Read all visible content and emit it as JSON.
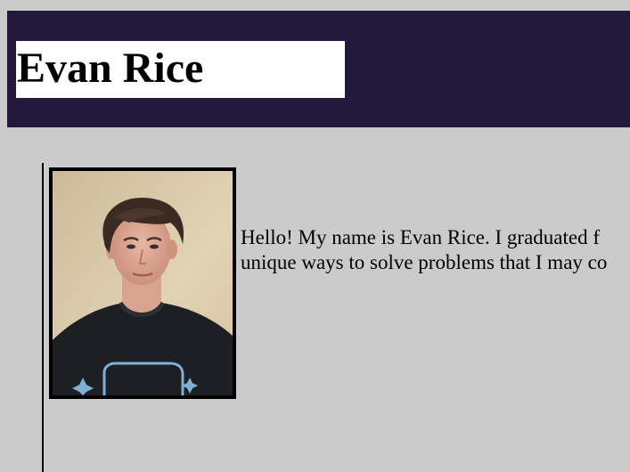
{
  "header": {
    "name": "Evan Rice"
  },
  "profile": {
    "photo_icon": "portrait-photo"
  },
  "bio": {
    "line1": "Hello! My name is Evan Rice. I graduated f",
    "line2": "unique ways to solve problems that I may co"
  },
  "colors": {
    "page_bg": "#cbcbcb",
    "header_bg": "#23193f",
    "name_box_bg": "#ffffff",
    "border": "#000000"
  }
}
